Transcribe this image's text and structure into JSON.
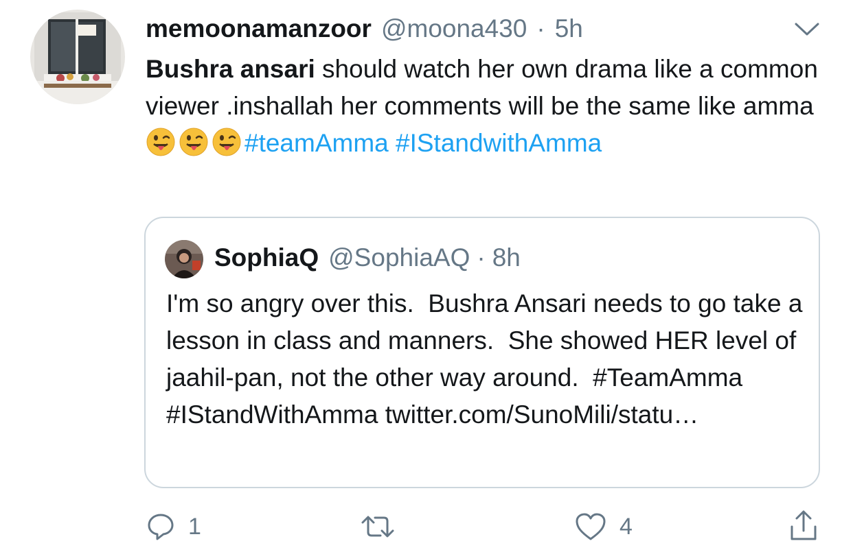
{
  "tweet": {
    "display_name": "memoonamanzoor",
    "handle": "@moona430",
    "separator": "·",
    "time": "5h",
    "text_bold": "Bushra ansari",
    "text_1": " should watch her own drama like a common viewer .inshallah her comments will be the same like amma ",
    "emojis": [
      "winking-face-with-tongue",
      "winking-face-with-tongue",
      "winking-face-with-tongue"
    ],
    "hashtags": [
      "#teamAmma",
      "#IStandwithAmma"
    ]
  },
  "quoted": {
    "display_name": "SophiaQ",
    "handle": "@SophiaAQ",
    "separator": "·",
    "time": "8h",
    "text": "I'm so angry over this.  Bushra Ansari needs to go take a lesson in class and manners.  She showed HER level of jaahil-pan, not the other way around.  #TeamAmma #IStandWithAmma twitter.com/SunoMili/statu…"
  },
  "actions": {
    "reply_count": "1",
    "retweet_count": "",
    "like_count": "4"
  },
  "colors": {
    "text": "#14171a",
    "secondary": "#657786",
    "link": "#1da1f2",
    "border": "#ccd6dd"
  }
}
